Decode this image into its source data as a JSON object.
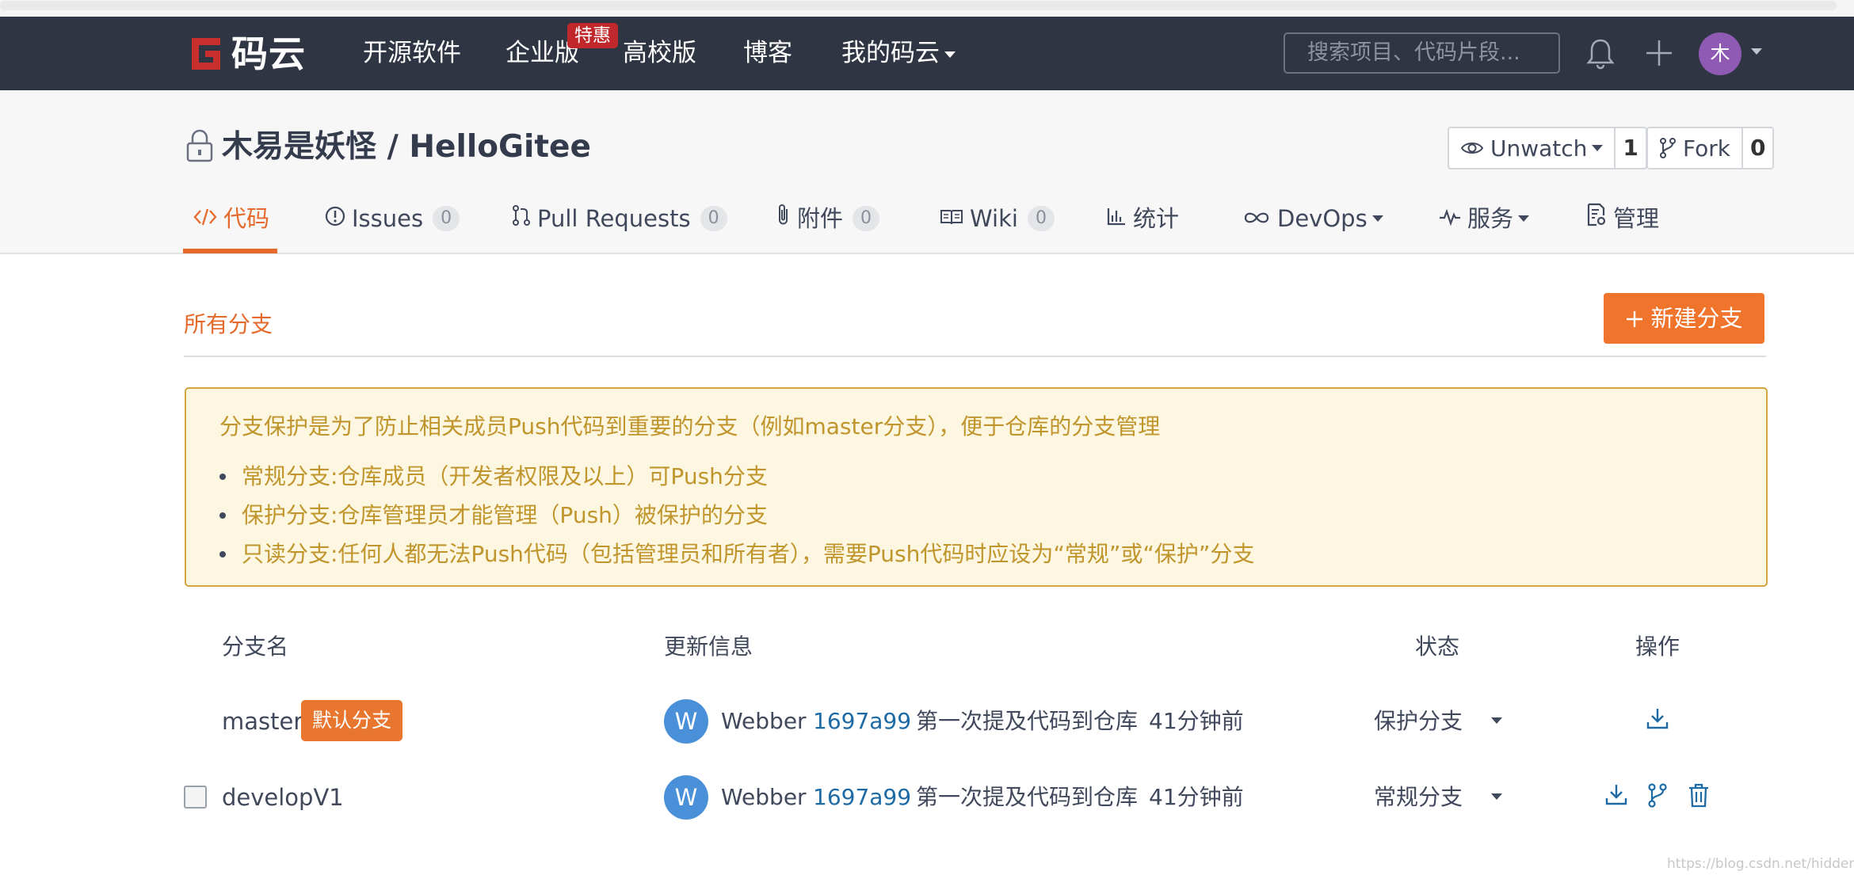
{
  "header": {
    "logo_text": "码云",
    "nav": [
      {
        "label": "开源软件"
      },
      {
        "label": "企业版"
      },
      {
        "label": "高校版"
      },
      {
        "label": "博客"
      },
      {
        "label": "我的码云"
      }
    ],
    "hot_badge": "特惠",
    "search_placeholder": "搜索项目、代码片段...",
    "avatar_initial": "木"
  },
  "repo": {
    "title": "木易是妖怪 / HelloGitee",
    "watch_label": "Unwatch",
    "watch_count": "1",
    "fork_label": "Fork",
    "fork_count": "0"
  },
  "tabs": [
    {
      "label": "代码",
      "active": true
    },
    {
      "label": "Issues",
      "count": "0"
    },
    {
      "label": "Pull Requests",
      "count": "0"
    },
    {
      "label": "附件",
      "count": "0"
    },
    {
      "label": "Wiki",
      "count": "0"
    },
    {
      "label": "统计"
    },
    {
      "label": "DevOps"
    },
    {
      "label": "服务"
    },
    {
      "label": "管理"
    }
  ],
  "branches_page": {
    "section_title": "所有分支",
    "new_branch_label": "新建分支",
    "notice": {
      "intro": "分支保护是为了防止相关成员Push代码到重要的分支（例如master分支），便于仓库的分支管理",
      "items": [
        "常规分支:仓库成员（开发者权限及以上）可Push分支",
        "保护分支:仓库管理员才能管理（Push）被保护的分支",
        "只读分支:任何人都无法Push代码（包括管理员和所有者），需要Push代码时应设为“常规”或“保护”分支"
      ]
    },
    "columns": {
      "name": "分支名",
      "update": "更新信息",
      "status": "状态",
      "actions": "操作"
    },
    "rows": [
      {
        "name": "master",
        "default_badge": "默认分支",
        "author_initial": "W",
        "author": "Webber",
        "sha": "1697a99",
        "message": "第一次提及代码到仓库",
        "time": "41分钟前",
        "status": "保护分支"
      },
      {
        "name": "developV1",
        "author_initial": "W",
        "author": "Webber",
        "sha": "1697a99",
        "message": "第一次提及代码到仓库",
        "time": "41分钟前",
        "status": "常规分支"
      }
    ]
  },
  "watermark": "https://blog.csdn.net/hidden_wb",
  "colors": {
    "header_bg": "#2f3542",
    "accent": "#e56a2c",
    "button_orange": "#f0742c",
    "notice_bg": "#fdf6e0",
    "notice_text": "#c0952c",
    "link": "#1d6aa5"
  }
}
